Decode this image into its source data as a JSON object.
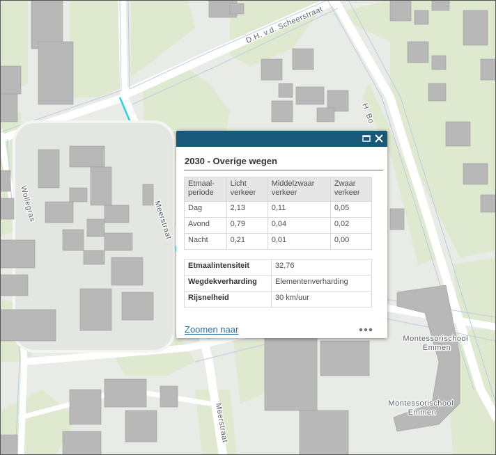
{
  "map": {
    "street_labels": {
      "scheerstraat": "D.H. v.d. Scheerstraat",
      "bo": "H. Bo",
      "meerstraat_1": "Meerstraat",
      "meerstraat_2": "Meerstraat",
      "wollegras": "Wollegras",
      "school_1": "Montessorischool\nEmmen",
      "school_2": "Montessorischool\nEmmen"
    },
    "highlight_color": "#1fd6dc"
  },
  "popup": {
    "title": "2030 - Overige wegen",
    "header_color": "#18597a",
    "icons": {
      "maximize": "maximize-icon",
      "close": "close-icon",
      "more": "more-options-icon"
    },
    "table1": {
      "headers": [
        "Etmaal-\nperiode",
        "Licht\nverkeer",
        "Middelzwaar\nverkeer",
        "Zwaar\nverkeer"
      ],
      "rows": [
        [
          "Dag",
          "2,13",
          "0,11",
          "0,05"
        ],
        [
          "Avond",
          "0,79",
          "0,04",
          "0,02"
        ],
        [
          "Nacht",
          "0,21",
          "0,01",
          "0,00"
        ]
      ]
    },
    "table2": {
      "rows": [
        [
          "Etmaalintensiteit",
          "32,76"
        ],
        [
          "Wegdekverharding",
          "Elementenverharding"
        ],
        [
          "Rijsnelheid",
          "30 km/uur"
        ]
      ]
    },
    "zoom_link": "Zoomen naar"
  }
}
